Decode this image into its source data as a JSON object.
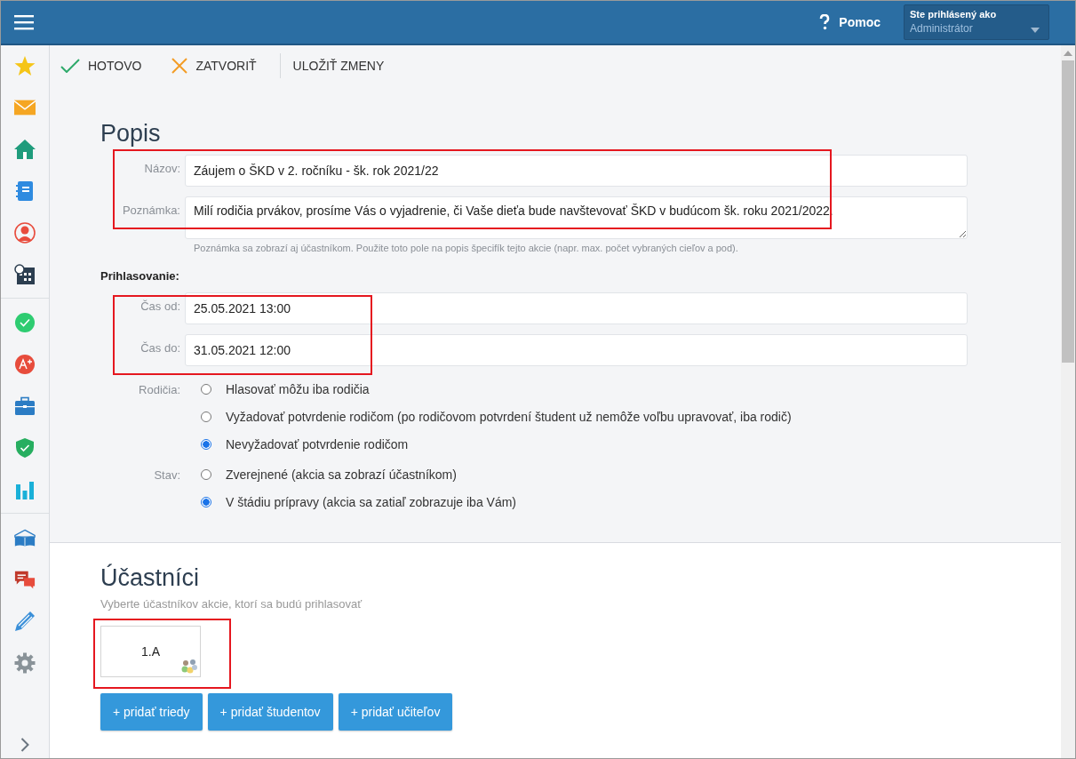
{
  "header": {
    "help": "Pomoc",
    "user_label": "Ste prihlásený ako",
    "user_name": "Administrátor"
  },
  "toolbar": [
    {
      "kind": "done",
      "label": "HOTOVO"
    },
    {
      "kind": "close",
      "label": "ZATVORIŤ"
    },
    {
      "kind": "save",
      "label": "ULOŽIŤ ZMENY"
    }
  ],
  "description": {
    "title": "Popis",
    "fields": [
      {
        "kind": "input",
        "label": "Názov:",
        "value": "Záujem o ŠKD v 2. ročníku - šk. rok 2021/22"
      },
      {
        "kind": "textarea",
        "label": "Poznámka:",
        "value": "Milí rodičia prvákov, prosíme Vás o vyjadrenie, či Vaše dieťa bude navštevovať ŠKD v budúcom šk. roku 2021/2022."
      }
    ],
    "hint": "Poznámka sa zobrazí aj účastníkom. Použite toto pole na popis špecifík tejto akcie (napr. max. počet vybraných cieľov a pod)."
  },
  "registration": {
    "title": "Prihlasovanie:",
    "fields": [
      {
        "label": "Čas od:",
        "value": "25.05.2021 13:00"
      },
      {
        "label": "Čas do:",
        "value": "31.05.2021 12:00"
      }
    ]
  },
  "radio_groups": [
    {
      "label": "Rodičia:",
      "options": [
        {
          "label": "Hlasovať môžu iba rodičia",
          "selected": false
        },
        {
          "label": "Vyžadovať potvrdenie rodičom (po rodičovom potvrdení študent už nemôže voľbu upravovať, iba rodič)",
          "selected": false
        },
        {
          "label": "Nevyžadovať potvrdenie rodičom",
          "selected": true
        }
      ]
    },
    {
      "label": "Stav:",
      "options": [
        {
          "label": "Zverejnené (akcia sa zobrazí účastníkom)",
          "selected": false
        },
        {
          "label": "V štádiu prípravy (akcia sa zatiaľ zobrazuje iba Vám)",
          "selected": true
        }
      ]
    }
  ],
  "participants": {
    "title": "Účastníci",
    "subtitle": "Vyberte účastníkov akcie, ktorí sa budú prihlasovať",
    "items": [
      {
        "label": "1.A"
      }
    ],
    "buttons": [
      "+ pridať triedy",
      "+ pridať študentov",
      "+ pridať učiteľov"
    ]
  }
}
